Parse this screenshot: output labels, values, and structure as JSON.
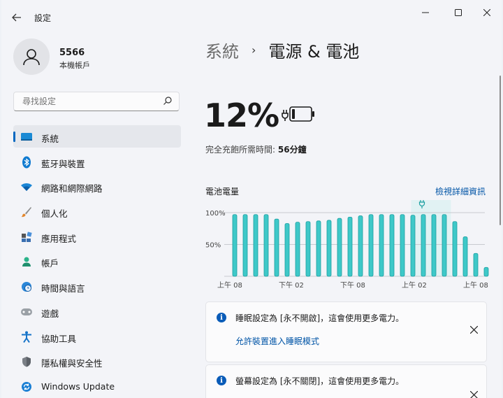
{
  "window": {
    "title": "設定",
    "back_icon": "arrow-left-icon",
    "controls": [
      "minimize-icon",
      "maximize-icon",
      "close-icon"
    ]
  },
  "profile": {
    "name": "5566",
    "type": "本機帳戶"
  },
  "search": {
    "placeholder": "尋找設定"
  },
  "nav": [
    {
      "label": "系統",
      "icon": "monitor-icon",
      "active": true
    },
    {
      "label": "藍牙與裝置",
      "icon": "bluetooth-icon"
    },
    {
      "label": "網路和網際網路",
      "icon": "wifi-icon"
    },
    {
      "label": "個人化",
      "icon": "brush-icon"
    },
    {
      "label": "應用程式",
      "icon": "apps-icon"
    },
    {
      "label": "帳戶",
      "icon": "person-icon"
    },
    {
      "label": "時間與語言",
      "icon": "globe-clock-icon"
    },
    {
      "label": "遊戲",
      "icon": "gamepad-icon"
    },
    {
      "label": "協助工具",
      "icon": "accessibility-icon"
    },
    {
      "label": "隱私權與安全性",
      "icon": "shield-icon"
    },
    {
      "label": "Windows Update",
      "icon": "update-icon"
    }
  ],
  "breadcrumb": {
    "parent": "系統",
    "separator": "›",
    "current": "電源 & 電池"
  },
  "battery": {
    "percent": "12%",
    "charging": true,
    "full_label": "完全充飽所需時間:",
    "full_value": "56分鐘"
  },
  "chart_data": {
    "type": "bar",
    "title": "電池電量",
    "x_tick_labels": [
      "上午 08",
      "下午 02",
      "下午 08",
      "上午 02",
      "上午 08"
    ],
    "y_tick_labels": [
      "100%",
      "50%"
    ],
    "ylim": [
      0,
      100
    ],
    "values": [
      97,
      97,
      97,
      97,
      90,
      83,
      85,
      86,
      87,
      88,
      91,
      93,
      95,
      97,
      97,
      97,
      97,
      96,
      97,
      97,
      97,
      86,
      62,
      36,
      14
    ],
    "plug_marker_index": 18,
    "highlight_start_index": 18,
    "bar_color": "#3ec8c8",
    "bar_outline": "#1b9ea0",
    "grid": true
  },
  "chart_link": "檢視詳細資訊",
  "cards": [
    {
      "message": "睡眠設定為 [永不開啟]，這會使用更多電力。",
      "link": "允許裝置進入睡眠模式"
    },
    {
      "message": "螢幕設定為 [永不關閉]，這會使用更多電力。"
    }
  ],
  "colors": {
    "accent": "#0067c0",
    "link": "#0054a6",
    "bar": "#3ec8c8"
  }
}
